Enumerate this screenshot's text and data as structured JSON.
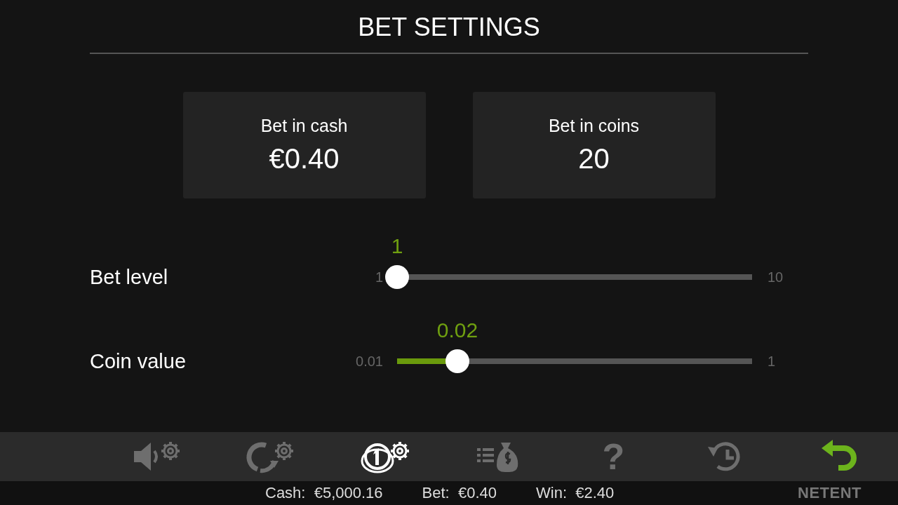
{
  "title": "BET SETTINGS",
  "cards": [
    {
      "label": "Bet in cash",
      "value": "€0.40"
    },
    {
      "label": "Bet in coins",
      "value": "20"
    }
  ],
  "sliders": [
    {
      "label": "Bet level",
      "value": "1",
      "min": "1",
      "max": "10",
      "level": 0
    },
    {
      "label": "Coin value",
      "value": "0.02",
      "min": "0.01",
      "max": "1",
      "level": 0.17
    }
  ],
  "toolbar": [
    {
      "kind": "sound",
      "selected": false
    },
    {
      "kind": "autoplay",
      "selected": false
    },
    {
      "kind": "bet",
      "selected": true
    },
    {
      "kind": "paytable",
      "selected": false
    },
    {
      "kind": "help",
      "selected": false,
      "glyph": "?"
    },
    {
      "kind": "history",
      "selected": false
    },
    {
      "kind": "back",
      "selected": false
    }
  ],
  "status": [
    {
      "label": "Cash:",
      "value": "€5,000.16"
    },
    {
      "label": "Bet:",
      "value": "€0.40"
    },
    {
      "label": "Win:",
      "value": "€2.40"
    }
  ],
  "logo": "NETENT"
}
